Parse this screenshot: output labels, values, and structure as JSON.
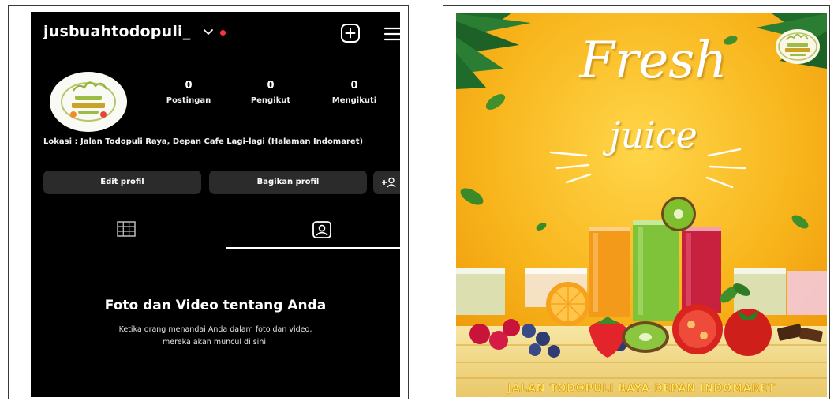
{
  "profile": {
    "username": "jusbuahtodopuli_",
    "stats": [
      {
        "value": "0",
        "label": "Postingan"
      },
      {
        "value": "0",
        "label": "Pengikut"
      },
      {
        "value": "0",
        "label": "Mengikuti"
      }
    ],
    "bio": "Lokasi : Jalan Todopuli Raya, Depan Cafe Lagi-lagi (Halaman Indomaret)",
    "buttons": {
      "edit": "Edit profil",
      "share": "Bagikan profil"
    },
    "empty_state": {
      "title": "Foto dan Video tentang Anda",
      "description": "Ketika orang menandai Anda dalam foto dan video, mereka akan muncul di sini."
    },
    "icons": {
      "account_switch": "chevron-down-icon",
      "create": "plus-square-icon",
      "menu": "hamburger-menu-icon",
      "add_person": "add-person-icon",
      "grid_tab": "grid-icon",
      "tagged_tab": "tagged-person-icon"
    },
    "colors": {
      "background": "#000000",
      "button": "#2b2b2b",
      "notification": "#ff3040"
    }
  },
  "poster": {
    "title": "Fresh",
    "subtitle": "juice",
    "footer": "JALAN TODOPULI RAYA DEPAN INDOMARET",
    "colors": {
      "background": "#f6b21a",
      "text": "#ffffff",
      "footer_text": "#ffe866"
    }
  }
}
